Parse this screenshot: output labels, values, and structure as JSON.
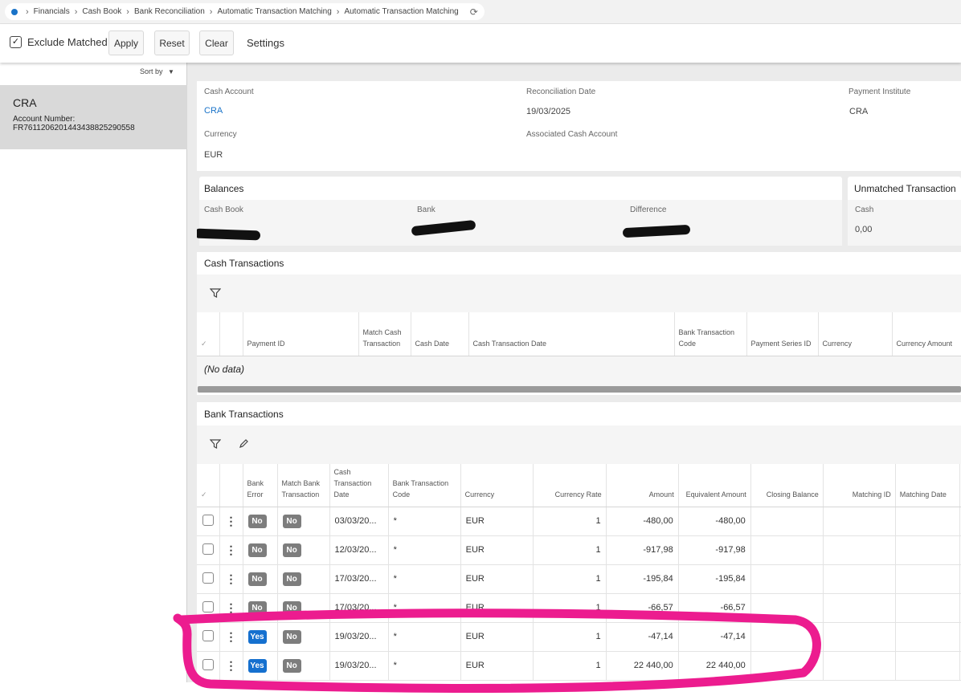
{
  "breadcrumb": {
    "items": [
      "Financials",
      "Cash Book",
      "Bank Reconciliation",
      "Automatic Transaction Matching",
      "Automatic Transaction Matching"
    ]
  },
  "toolbar": {
    "exclude_matched_label": "Exclude Matched",
    "exclude_matched_checked": true,
    "apply_label": "Apply",
    "reset_label": "Reset",
    "clear_label": "Clear",
    "settings_label": "Settings"
  },
  "left_panel": {
    "sort_label": "Sort by",
    "account": {
      "name": "CRA",
      "number_label": "Account Number:",
      "number": "FR7611206201443438825290558"
    }
  },
  "details": {
    "cash_account_label": "Cash Account",
    "cash_account_value": "CRA",
    "reconciliation_date_label": "Reconciliation Date",
    "reconciliation_date_value": "19/03/2025",
    "payment_institute_label": "Payment Institute",
    "payment_institute_value": "CRA",
    "currency_label": "Currency",
    "currency_value": "EUR",
    "associated_cash_account_label": "Associated Cash Account"
  },
  "balances": {
    "title": "Balances",
    "cash_book_label": "Cash Book",
    "bank_label": "Bank",
    "difference_label": "Difference"
  },
  "unmatched": {
    "title": "Unmatched Transaction",
    "cash_label": "Cash",
    "cash_value": "0,00"
  },
  "cash_transactions": {
    "title": "Cash Transactions",
    "columns": [
      "Payment ID",
      "Match Cash Transaction",
      "Cash Date",
      "Cash Transaction Date",
      "Bank Transaction Code",
      "Payment Series ID",
      "Currency",
      "Currency Amount"
    ],
    "no_data": "(No data)"
  },
  "bank_transactions": {
    "title": "Bank Transactions",
    "columns": [
      "Bank Error",
      "Match Bank Transaction",
      "Cash Transaction Date",
      "Bank Transaction Code",
      "Currency",
      "Currency Rate",
      "Amount",
      "Equivalent Amount",
      "Closing Balance",
      "Matching ID",
      "Matching Date"
    ],
    "rows": [
      {
        "bank_error": "No",
        "match": "No",
        "date": "03/03/20...",
        "code": "*",
        "currency": "EUR",
        "rate": "1",
        "amount": "-480,00",
        "equivalent": "-480,00"
      },
      {
        "bank_error": "No",
        "match": "No",
        "date": "12/03/20...",
        "code": "*",
        "currency": "EUR",
        "rate": "1",
        "amount": "-917,98",
        "equivalent": "-917,98"
      },
      {
        "bank_error": "No",
        "match": "No",
        "date": "17/03/20...",
        "code": "*",
        "currency": "EUR",
        "rate": "1",
        "amount": "-195,84",
        "equivalent": "-195,84"
      },
      {
        "bank_error": "No",
        "match": "No",
        "date": "17/03/20...",
        "code": "*",
        "currency": "EUR",
        "rate": "1",
        "amount": "-66,57",
        "equivalent": "-66,57"
      },
      {
        "bank_error": "Yes",
        "match": "No",
        "date": "19/03/20...",
        "code": "*",
        "currency": "EUR",
        "rate": "1",
        "amount": "-47,14",
        "equivalent": "-47,14"
      },
      {
        "bank_error": "Yes",
        "match": "No",
        "date": "19/03/20...",
        "code": "*",
        "currency": "EUR",
        "rate": "1",
        "amount": "22 440,00",
        "equivalent": "22 440,00"
      }
    ]
  },
  "colors": {
    "accent": "#1a73c8",
    "yes_badge": "#1570cf",
    "no_badge": "#7d7d7d",
    "annotation": "#ec1c8f"
  }
}
